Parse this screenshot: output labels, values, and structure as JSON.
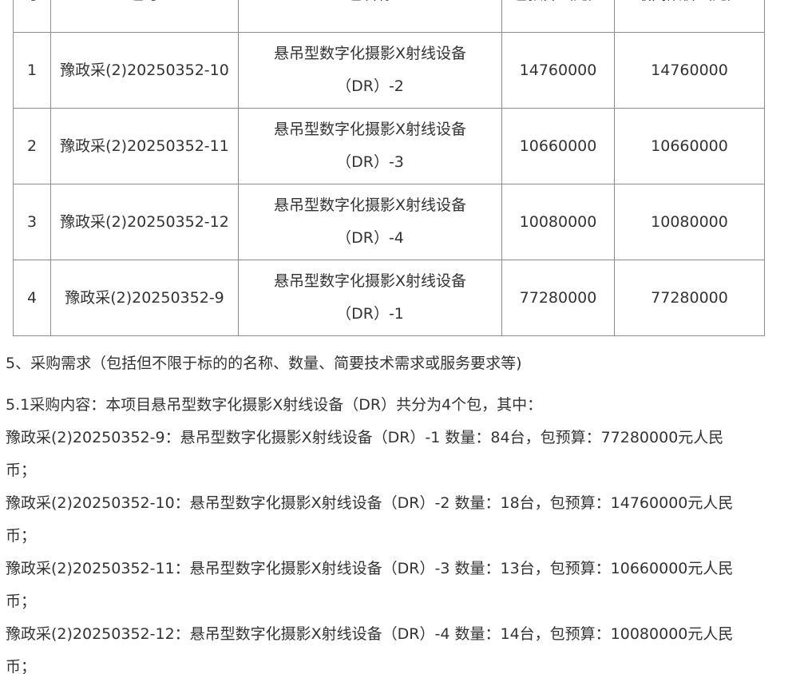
{
  "table": {
    "headers": [
      "号",
      "包号",
      "包名称",
      "包预算（元）",
      "最高限价（元）"
    ],
    "rows": [
      {
        "idx": "1",
        "code": "豫政采(2)20250352-10",
        "name_line1": "悬吊型数字化摄影X射线设备",
        "name_line2": "（DR）-2",
        "budget": "14760000",
        "max_price": "14760000"
      },
      {
        "idx": "2",
        "code": "豫政采(2)20250352-11",
        "name_line1": "悬吊型数字化摄影X射线设备",
        "name_line2": "（DR）-3",
        "budget": "10660000",
        "max_price": "10660000"
      },
      {
        "idx": "3",
        "code": "豫政采(2)20250352-12",
        "name_line1": "悬吊型数字化摄影X射线设备",
        "name_line2": "（DR）-4",
        "budget": "10080000",
        "max_price": "10080000"
      },
      {
        "idx": "4",
        "code": "豫政采(2)20250352-9",
        "name_line1": "悬吊型数字化摄影X射线设备",
        "name_line2": "（DR）-1",
        "budget": "77280000",
        "max_price": "77280000"
      }
    ]
  },
  "section5": {
    "heading": "5、采购需求（包括但不限于标的的名称、数量、简要技术需求或服务要求等)",
    "intro": "5.1采购内容：本项目悬吊型数字化摄影X射线设备（DR）共分为4个包，其中：",
    "items": [
      {
        "line1": "豫政采(2)20250352-9：悬吊型数字化摄影X射线设备（DR）-1 数量：84台，包预算：77280000元人民",
        "line2": "币；"
      },
      {
        "line1": "豫政采(2)20250352-10：悬吊型数字化摄影X射线设备（DR）-2 数量：18台，包预算：14760000元人民",
        "line2": "币；"
      },
      {
        "line1": "豫政采(2)20250352-11：悬吊型数字化摄影X射线设备（DR）-3 数量：13台，包预算：10660000元人民",
        "line2": "币；"
      },
      {
        "line1": "豫政采(2)20250352-12：悬吊型数字化摄影X射线设备（DR）-4 数量：14台，包预算：10080000元人民",
        "line2": "币；"
      }
    ]
  }
}
